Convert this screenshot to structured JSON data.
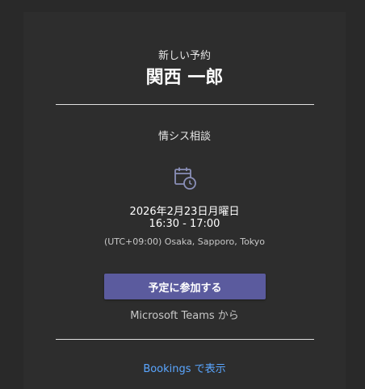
{
  "header": {
    "subtitle": "新しい予約",
    "customer_name": "関西 一郎"
  },
  "booking": {
    "service_name": "情シス相談",
    "date": "2026年2月23日月曜日",
    "time_range": "16:30 - 17:00",
    "timezone": "(UTC+09:00) Osaka, Sapporo, Tokyo",
    "icon": "calendar-clock-icon"
  },
  "actions": {
    "join_label": "予定に参加する",
    "join_source": "Microsoft Teams から",
    "view_link": "Bookings で表示"
  },
  "colors": {
    "background": "#292929",
    "card": "#2d2d2d",
    "button": "#5b5b9e",
    "link": "#5aa6ff",
    "icon": "#8a8fb8"
  }
}
